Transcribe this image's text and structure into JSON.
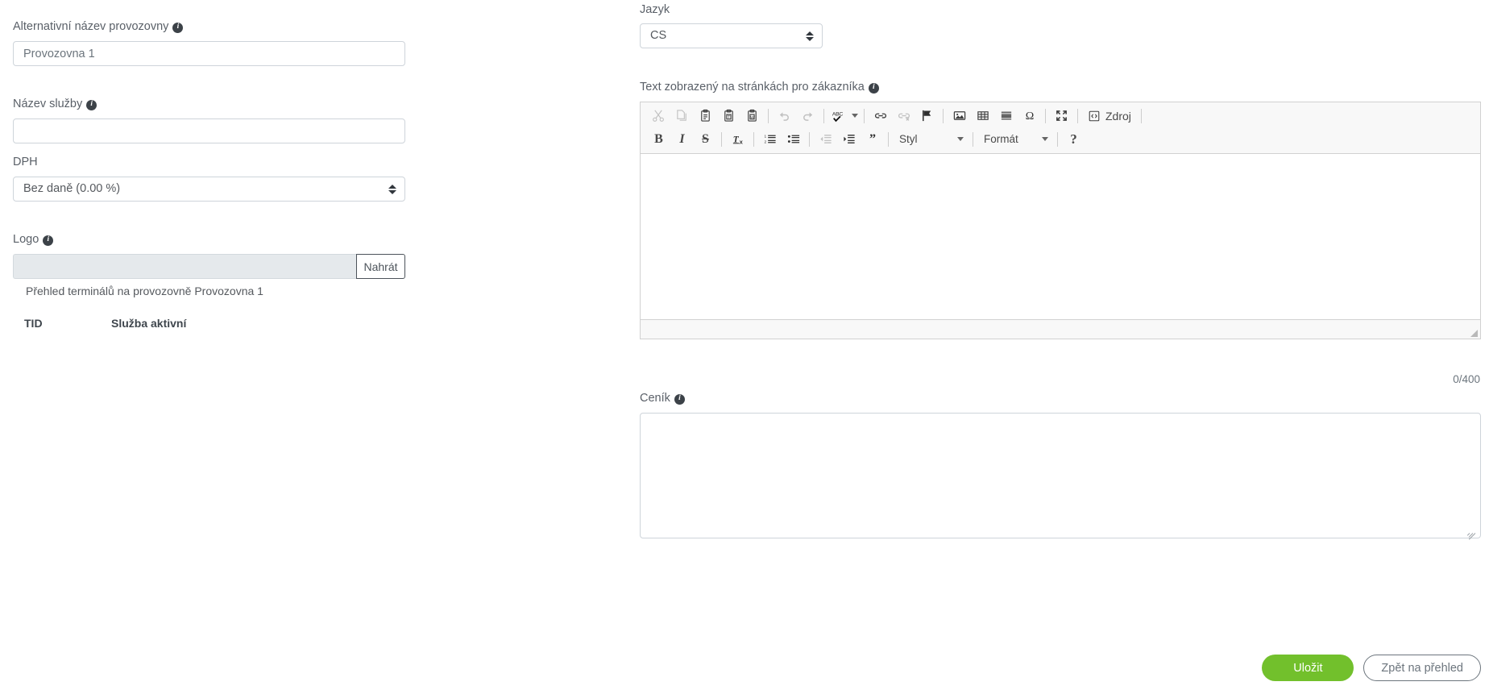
{
  "left": {
    "alt_name": {
      "label": "Alternativní název provozovny",
      "info": "i",
      "value": "Provozovna 1"
    },
    "service_name": {
      "label": "Název služby",
      "info": "i",
      "value": ""
    },
    "vat": {
      "label": "DPH",
      "selected": "Bez daně (0.00 %)"
    },
    "logo": {
      "label": "Logo",
      "info": "i",
      "file_value": "",
      "upload_button": "Nahrát"
    },
    "terminals": {
      "caption": "Přehled terminálů na provozovně Provozovna 1",
      "columns": [
        "TID",
        "Služba aktivní"
      ],
      "rows": []
    }
  },
  "right": {
    "language": {
      "label": "Jazyk",
      "selected": "CS"
    },
    "customer_text": {
      "label": "Text zobrazený na stránkách pro zákazníka",
      "info": "i",
      "content": "",
      "counter": "0/400"
    },
    "editor_toolbar": {
      "row1": [
        {
          "name": "cut-icon",
          "title": "Vyjmout",
          "disabled": true
        },
        {
          "name": "copy-icon",
          "title": "Kopírovat",
          "disabled": true
        },
        {
          "name": "paste-icon",
          "title": "Vložit",
          "disabled": false
        },
        {
          "name": "paste-text-icon",
          "title": "Vložit jako čistý text",
          "disabled": false
        },
        {
          "name": "paste-word-icon",
          "title": "Vložit z Wordu",
          "disabled": false
        },
        {
          "name": "separator",
          "title": "",
          "disabled": false
        },
        {
          "name": "undo-icon",
          "title": "Zpět",
          "disabled": true
        },
        {
          "name": "redo-icon",
          "title": "Znovu",
          "disabled": true
        },
        {
          "name": "separator",
          "title": "",
          "disabled": false
        },
        {
          "name": "spellcheck-icon",
          "title": "Kontrola pravopisu",
          "disabled": false
        },
        {
          "name": "separator",
          "title": "",
          "disabled": false
        },
        {
          "name": "link-icon",
          "title": "Vložit/změnit odkaz",
          "disabled": false
        },
        {
          "name": "unlink-icon",
          "title": "Odstranit odkaz",
          "disabled": true
        },
        {
          "name": "anchor-flag-icon",
          "title": "Kotva",
          "disabled": false
        },
        {
          "name": "separator",
          "title": "",
          "disabled": false
        },
        {
          "name": "image-icon",
          "title": "Obrázek",
          "disabled": false
        },
        {
          "name": "table-icon",
          "title": "Tabulka",
          "disabled": false
        },
        {
          "name": "horizontal-rule-icon",
          "title": "Vodorovná linka",
          "disabled": false
        },
        {
          "name": "special-char-icon",
          "title": "Speciální znak",
          "disabled": false
        },
        {
          "name": "separator",
          "title": "",
          "disabled": false
        },
        {
          "name": "maximize-icon",
          "title": "Maximalizovat",
          "disabled": false
        },
        {
          "name": "separator",
          "title": "",
          "disabled": false
        },
        {
          "name": "source-icon",
          "title": "Zdroj",
          "disabled": false,
          "label": "Zdroj"
        },
        {
          "name": "separator",
          "title": "",
          "disabled": false
        }
      ],
      "row2": [
        {
          "name": "bold-icon",
          "glyph": "B",
          "cls": "ck-bold"
        },
        {
          "name": "italic-icon",
          "glyph": "I",
          "cls": "ck-ital"
        },
        {
          "name": "strikethrough-icon",
          "glyph": "S",
          "cls": "ck-strike"
        },
        {
          "name": "separator"
        },
        {
          "name": "remove-format-icon"
        },
        {
          "name": "separator"
        },
        {
          "name": "numbered-list-icon"
        },
        {
          "name": "bulleted-list-icon"
        },
        {
          "name": "separator"
        },
        {
          "name": "outdent-icon",
          "disabled": true
        },
        {
          "name": "indent-icon"
        },
        {
          "name": "blockquote-icon",
          "glyph": "”"
        },
        {
          "name": "separator"
        }
      ],
      "style_combo": "Styl",
      "format_combo": "Formát",
      "help_glyph": "?"
    },
    "price_list": {
      "label": "Ceník",
      "info": "i",
      "value": ""
    }
  },
  "footer": {
    "save_label": "Uložit",
    "back_label": "Zpět na přehled",
    "save_color": "#72c02c"
  }
}
